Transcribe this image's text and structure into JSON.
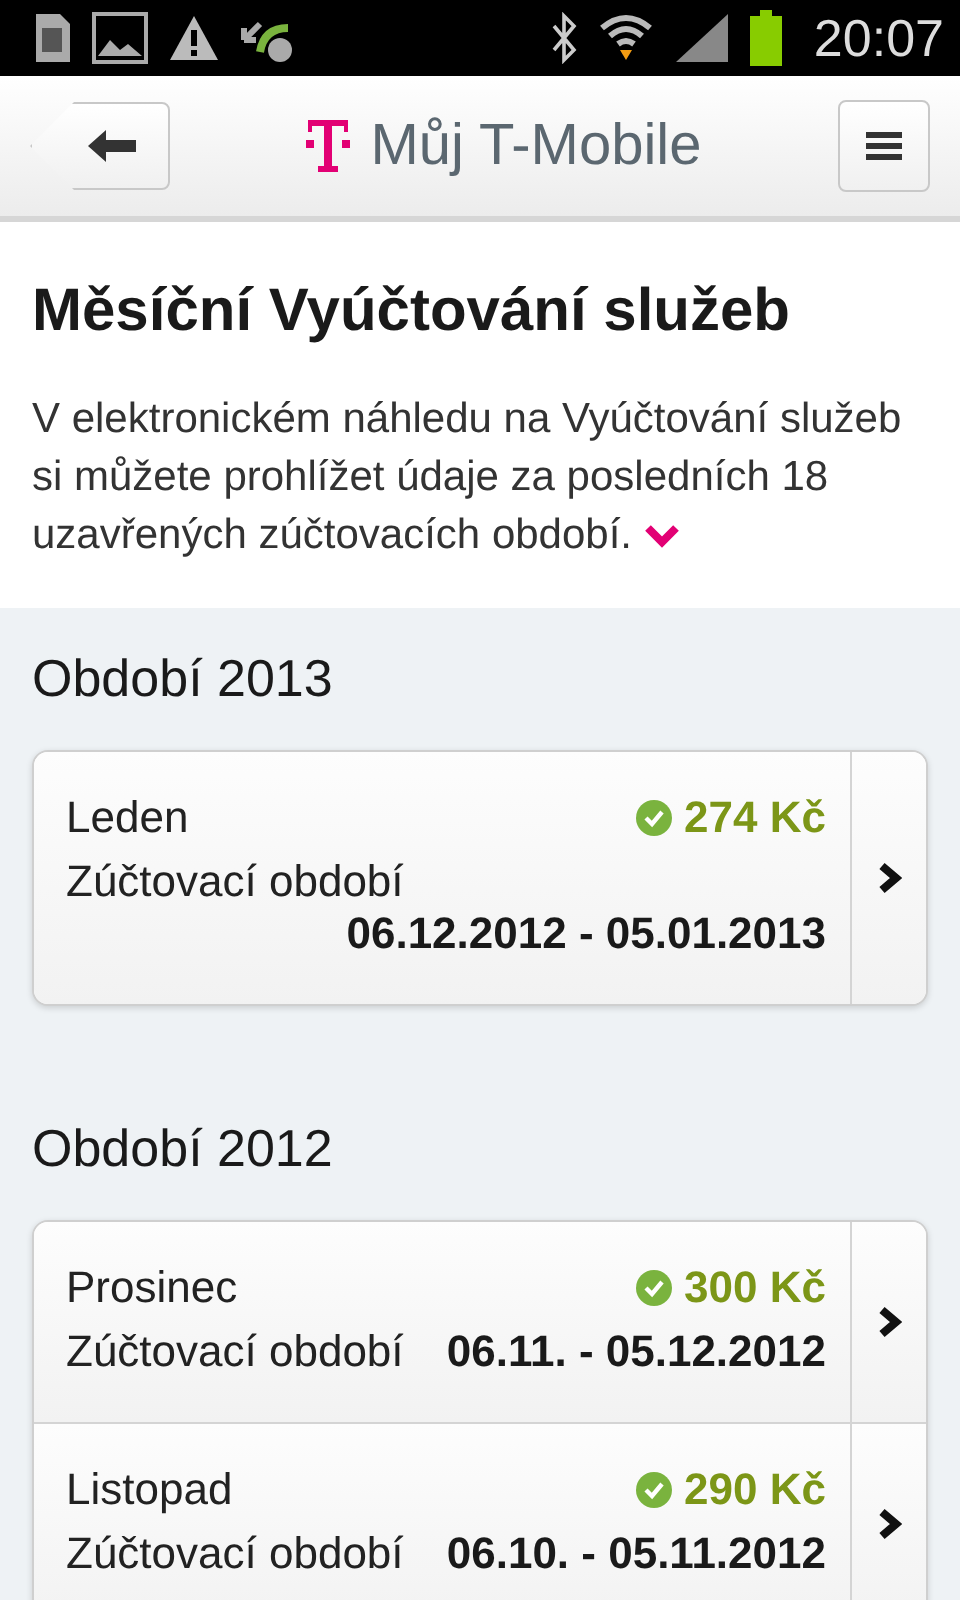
{
  "status_bar": {
    "time": "20:07"
  },
  "header": {
    "title": "Můj T-Mobile"
  },
  "intro": {
    "title": "Měsíční Vyúčtování služeb",
    "text": "V elektronickém náhledu na Vyúčtování služeb si můžete prohlížet údaje za posledních 18 uzavřených zúčtovacích období.",
    "expanded": false
  },
  "sections": [
    {
      "title": "Období 2013",
      "bills": [
        {
          "month": "Leden",
          "amount": "274 Kč",
          "paid": true,
          "period_label": "Zúčtovací období",
          "period": "06.12.2012 - 05.01.2013"
        }
      ]
    },
    {
      "title": "Období 2012",
      "bills": [
        {
          "month": "Prosinec",
          "amount": "300 Kč",
          "paid": true,
          "period_label": "Zúčtovací období",
          "period": "06.11. - 05.12.2012"
        },
        {
          "month": "Listopad",
          "amount": "290 Kč",
          "paid": true,
          "period_label": "Zúčtovací období",
          "period": "06.10. - 05.11.2012"
        }
      ]
    }
  ]
}
